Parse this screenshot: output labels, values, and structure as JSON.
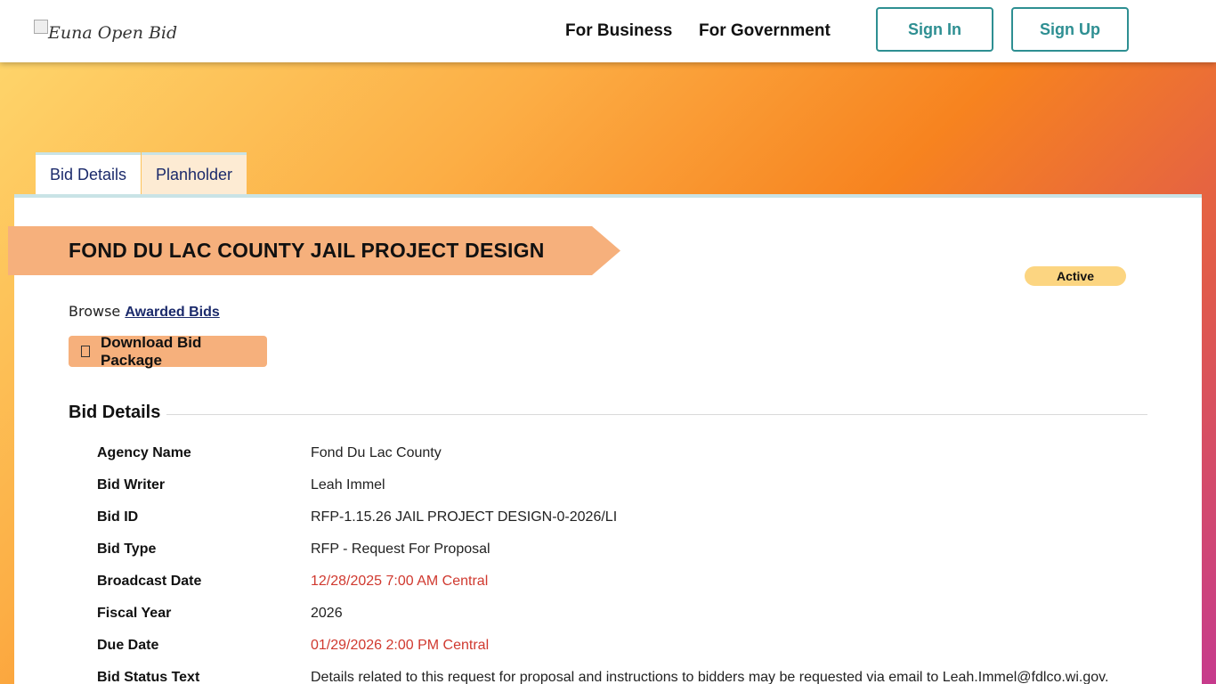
{
  "header": {
    "logo_alt": "Euna Open Bid",
    "nav": [
      "For Business",
      "For Government"
    ],
    "sign_in": "Sign In",
    "sign_up": "Sign Up"
  },
  "tabs": [
    {
      "label": "Bid Details",
      "active": true
    },
    {
      "label": "Planholder",
      "active": false
    }
  ],
  "bid": {
    "title": "FOND DU LAC COUNTY JAIL PROJECT DESIGN",
    "status": "Active",
    "browse_prefix": "Browse",
    "browse_link": "Awarded Bids",
    "download_label": "Download Bid Package",
    "section_heading": "Bid Details"
  },
  "details": [
    {
      "label": "Agency Name",
      "value": "Fond Du Lac County",
      "highlight": false
    },
    {
      "label": "Bid Writer",
      "value": "Leah Immel",
      "highlight": false
    },
    {
      "label": "Bid ID",
      "value": "RFP-1.15.26 JAIL PROJECT DESIGN-0-2026/LI",
      "highlight": false
    },
    {
      "label": "Bid Type",
      "value": "RFP - Request For Proposal",
      "highlight": false
    },
    {
      "label": "Broadcast Date",
      "value": "12/28/2025 7:00 AM Central",
      "highlight": true
    },
    {
      "label": "Fiscal Year",
      "value": "2026",
      "highlight": false
    },
    {
      "label": "Due Date",
      "value": "01/29/2026 2:00 PM Central",
      "highlight": true
    },
    {
      "label": "Bid Status Text",
      "value": "Details related to this request for proposal and instructions to bidders may be requested via email to Leah.Immel@fdlco.wi.gov.",
      "highlight": false
    }
  ],
  "colors": {
    "accent_teal": "#2e8f92",
    "ribbon": "#f6b07c",
    "status_badge": "#fcd581",
    "date_red": "#d0392f",
    "link_navy": "#1b2a6b"
  }
}
